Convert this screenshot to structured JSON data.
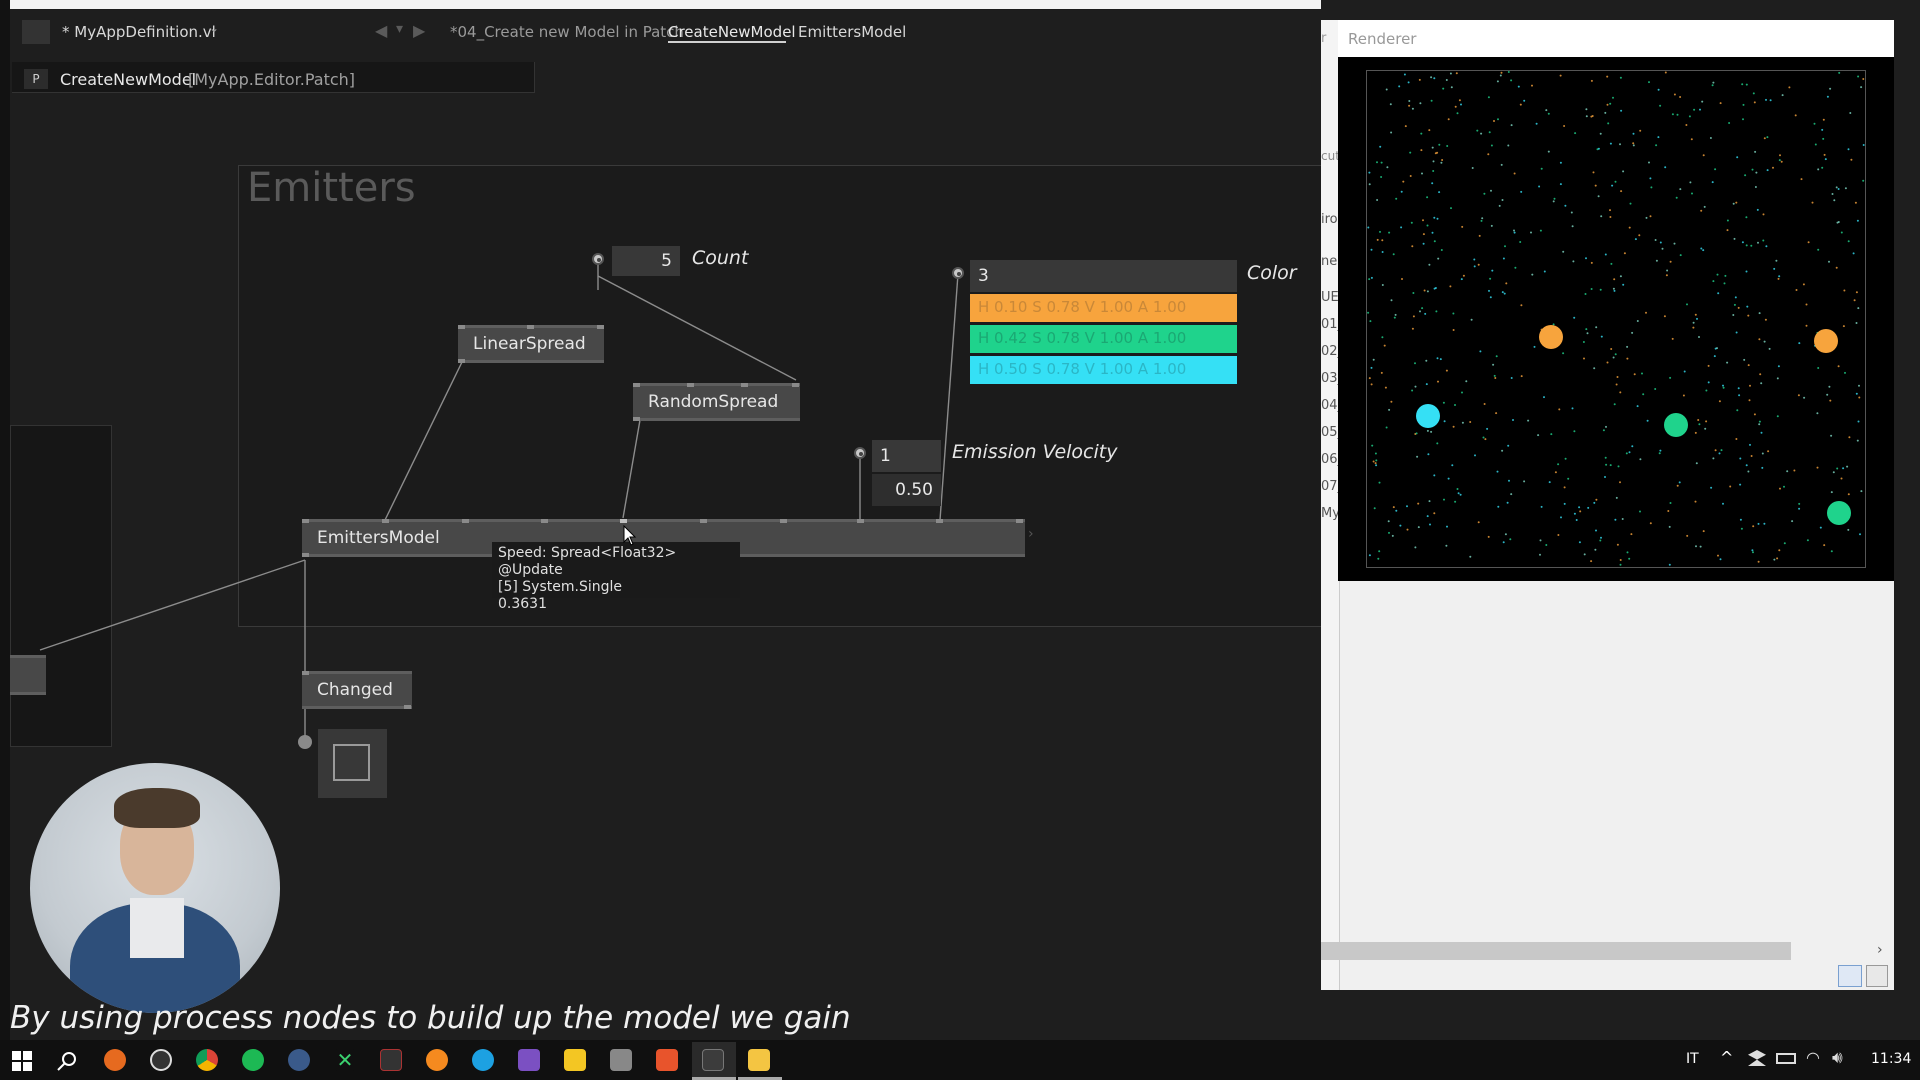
{
  "editor": {
    "doc_title": "* MyAppDefinition.vl",
    "breadcrumbs": [
      "*04_Create new Model in Patch",
      "CreateNewModel",
      "EmittersModel"
    ],
    "patch_header_prefix": "P",
    "patch_header_name": "CreateNewModel",
    "patch_header_type": "[MyApp.Editor.Patch]",
    "region_title": "Emitters",
    "count_value": "5",
    "count_label": "Count",
    "linear_spread": "LinearSpread",
    "random_spread": "RandomSpread",
    "color_count": "3",
    "color_label": "Color",
    "colors": [
      {
        "text": "H 0.10 S 0.78 V 1.00 A 1.00",
        "bg": "#f7a43d"
      },
      {
        "text": "H 0.42 S 0.78 V 1.00 A 1.00",
        "bg": "#1fd38c"
      },
      {
        "text": "H 0.50 S 0.78 V 1.00 A 1.00",
        "bg": "#35e0f5"
      }
    ],
    "velocity_count": "1",
    "velocity_value": "0.50",
    "velocity_label": "Emission Velocity",
    "emitters_model": "EmittersModel",
    "tooltip_line1": "Speed: Spread<Float32> @Update",
    "tooltip_line2": "[5] System.Single",
    "tooltip_line3": "0.3631",
    "changed_node": "Changed"
  },
  "renderer": {
    "title": "Renderer",
    "partial_labels": [
      "r",
      "cut",
      "iro",
      "ne",
      "UE",
      "01_",
      "02_",
      "03_",
      "04_",
      "05_",
      "06_",
      "07_",
      "My"
    ]
  },
  "subtitle": "By using process nodes to build up the model we gain",
  "taskbar": {
    "language": "IT",
    "time": "11:34"
  }
}
